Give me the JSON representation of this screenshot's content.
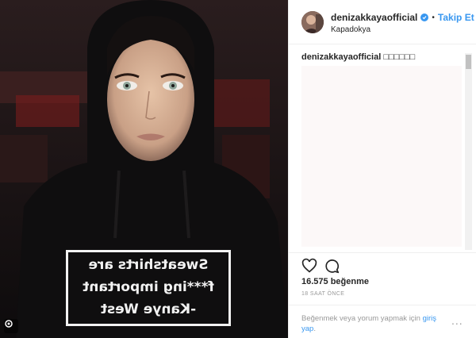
{
  "post": {
    "hoodie_lines": [
      "Sweatshirts are",
      "f***ing important",
      "-Kanye West"
    ]
  },
  "header": {
    "username": "denizakkaya​official",
    "dot": "•",
    "follow_label": "Takip Et",
    "location": "Kapadokya"
  },
  "comments": {
    "caption_user": "denizakkaya​official",
    "caption_text": "□□□□□□"
  },
  "actions": {
    "likes": "16.575 beğenme",
    "time": "18 SAAT ÖNCE"
  },
  "footer": {
    "prompt": "Beğenmek veya yorum yapmak için",
    "login_link": "giriş yap",
    "period": ".",
    "more": "..."
  },
  "colors": {
    "accent": "#3897f0",
    "muted": "#999999",
    "border": "#efefef"
  }
}
